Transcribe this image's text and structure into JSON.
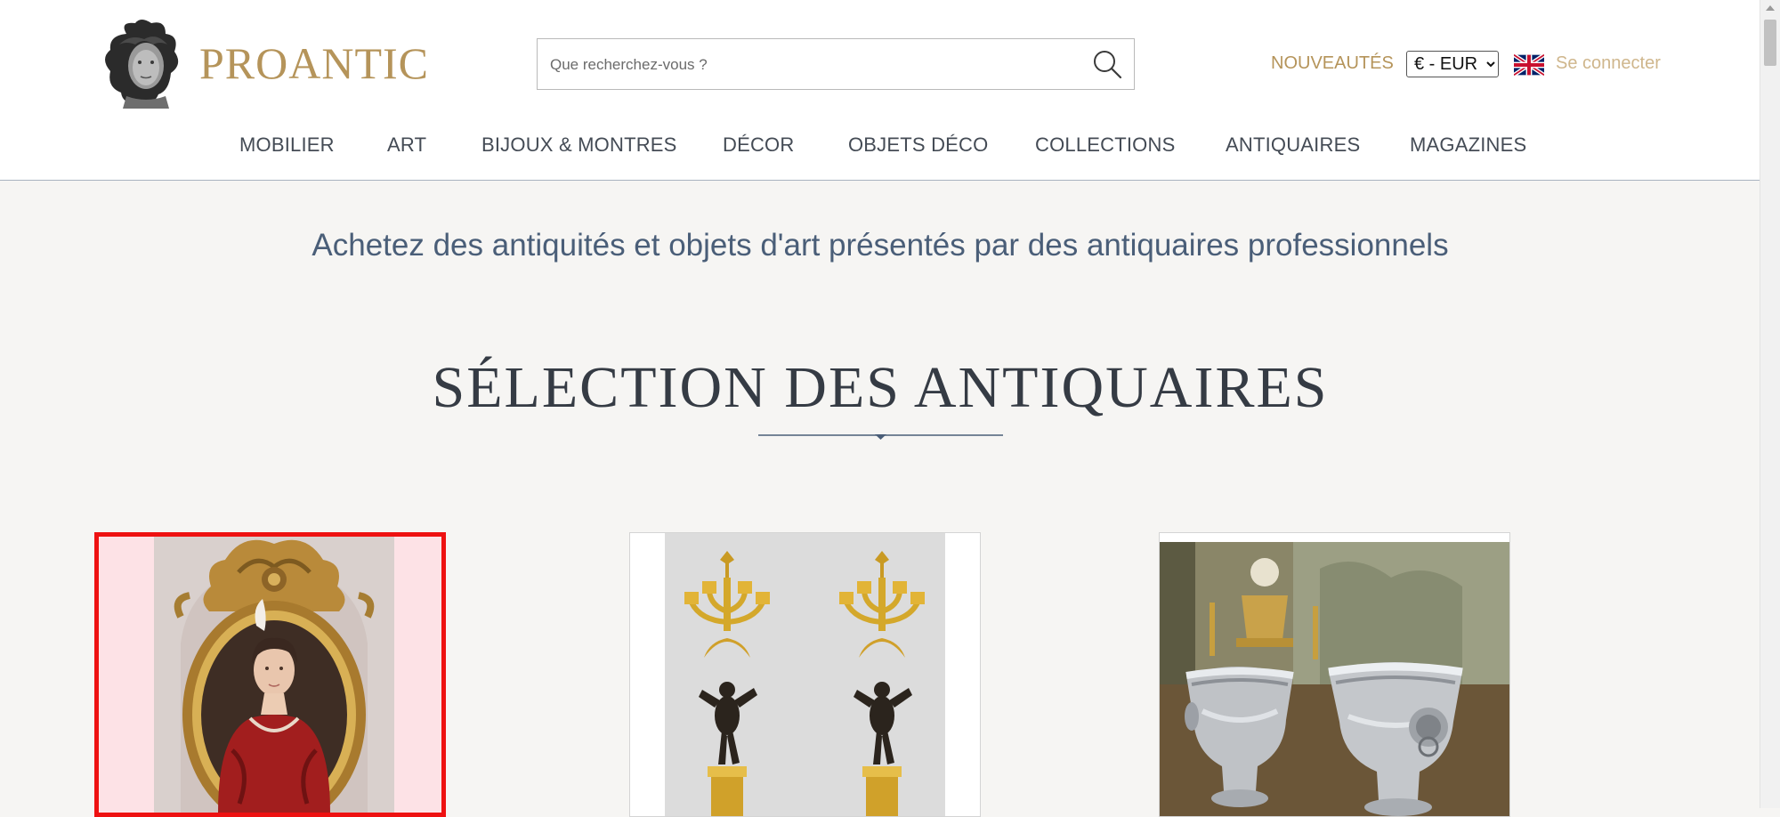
{
  "brand": {
    "name": "PROANTIC"
  },
  "search": {
    "placeholder": "Que recherchez-vous ?",
    "value": ""
  },
  "header_links": {
    "nouveautes": "NOUVEAUTÉS",
    "currency_selected": "€ - EUR",
    "language_flag": "uk-flag-icon",
    "login": "Se connecter"
  },
  "nav": {
    "items": [
      {
        "label": "MOBILIER"
      },
      {
        "label": "ART"
      },
      {
        "label": "BIJOUX & MONTRES"
      },
      {
        "label": "DÉCOR"
      },
      {
        "label": "OBJETS DÉCO"
      },
      {
        "label": "COLLECTIONS"
      },
      {
        "label": "ANTIQUAIRES"
      },
      {
        "label": "MAGAZINES"
      }
    ]
  },
  "hero": {
    "tagline": "Achetez des antiquités et objets d'art présentés par des antiquaires professionnels"
  },
  "selection": {
    "title": "SÉLECTION DES ANTIQUAIRES",
    "products": [
      {
        "image": "portrait-in-gilt-oval-frame",
        "selected": true
      },
      {
        "image": "pair-of-gilt-bronze-candelabra",
        "selected": false
      },
      {
        "image": "pair-of-silver-wine-coolers",
        "selected": false
      }
    ]
  },
  "colors": {
    "brand_gold": "#b5945a",
    "nav_text": "#444b55",
    "tagline": "#4a5e78",
    "selection_border": "#ee1111",
    "background": "#f6f5f3"
  }
}
